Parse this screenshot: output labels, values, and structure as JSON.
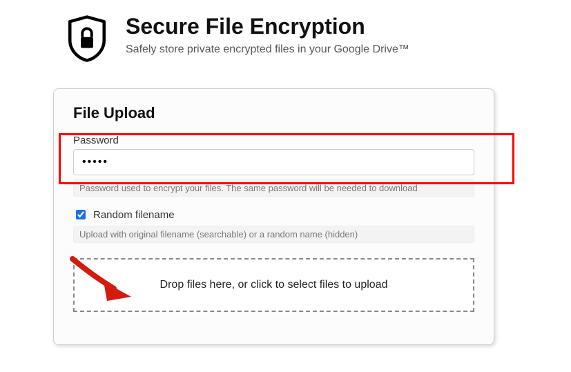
{
  "header": {
    "title": "Secure File Encryption",
    "subtitle": "Safely store private encrypted files in your Google Drive™"
  },
  "card": {
    "title": "File Upload",
    "password": {
      "label": "Password",
      "value": "•••••",
      "hint": "Password used to encrypt your files. The same password will be needed to download"
    },
    "random_filename": {
      "checked": true,
      "label": "Random filename",
      "hint": "Upload with original filename (searchable) or a random name (hidden)"
    },
    "dropzone": {
      "text": "Drop files here, or click to select files to upload"
    }
  },
  "annotations": {
    "highlight_color": "#ff0000",
    "arrow_color": "#d41b0f"
  }
}
